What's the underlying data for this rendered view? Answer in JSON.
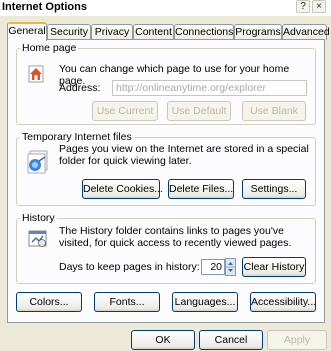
{
  "window": {
    "title": "Internet Options",
    "help_glyph": "?",
    "close_glyph": "×"
  },
  "tabs": [
    {
      "label": "General",
      "active": true
    },
    {
      "label": "Security"
    },
    {
      "label": "Privacy"
    },
    {
      "label": "Content"
    },
    {
      "label": "Connections"
    },
    {
      "label": "Programs"
    },
    {
      "label": "Advanced"
    }
  ],
  "home_page": {
    "legend": "Home page",
    "description": "You can change which page to use for your home page.",
    "address_label": "Address:",
    "address_value": "http://onlineanytime.org/explorer",
    "buttons": {
      "use_current": "Use Current",
      "use_default": "Use Default",
      "use_blank": "Use Blank"
    },
    "icon": "home-icon"
  },
  "temp_files": {
    "legend": "Temporary Internet files",
    "description": "Pages you view on the Internet are stored in a special folder for quick viewing later.",
    "buttons": {
      "delete_cookies": "Delete Cookies...",
      "delete_files": "Delete Files...",
      "settings": "Settings..."
    },
    "icon": "temporary-files-icon"
  },
  "history": {
    "legend": "History",
    "description": "The History folder contains links to pages you've visited, for quick access to recently viewed pages.",
    "days_label": "Days to keep pages in history:",
    "days_value": "20",
    "clear_button": "Clear History",
    "icon": "history-icon"
  },
  "bottom_buttons": {
    "colors": "Colors...",
    "fonts": "Fonts...",
    "languages": "Languages...",
    "accessibility": "Accessibility..."
  },
  "dialog_buttons": {
    "ok": "OK",
    "cancel": "Cancel",
    "apply": "Apply"
  }
}
